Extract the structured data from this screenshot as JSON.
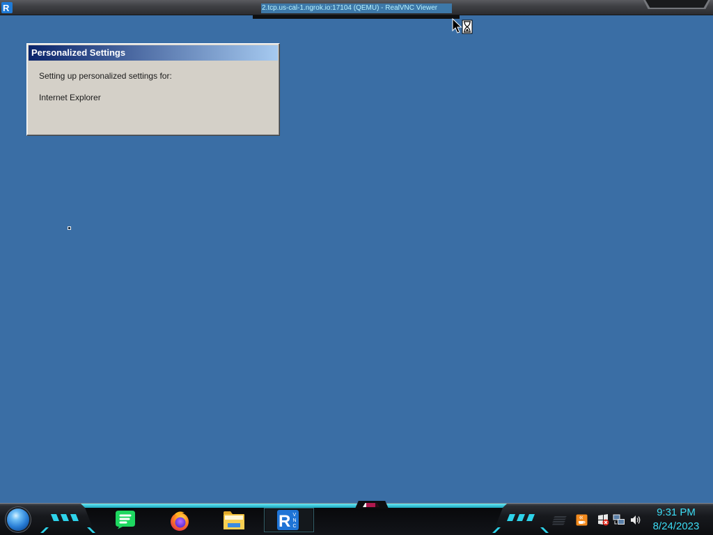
{
  "vnc_viewer": {
    "title": "2.tcp.us-cal-1.ngrok.io:17104 (QEMU) - RealVNC Viewer",
    "icon": "realvnc-icon"
  },
  "realvnc_logo": {
    "mark": "R",
    "letters": [
      "V",
      "N",
      "C"
    ]
  },
  "dialog": {
    "title": "Personalized Settings",
    "message": "Setting up personalized settings for:",
    "item": "Internet Explorer"
  },
  "cursor": {
    "icon": "busy-cursor-icon"
  },
  "taskbar": {
    "start_icon": "start-orb-icon",
    "pinned": [
      {
        "icon": "spotify-icon"
      },
      {
        "icon": "firefox-icon"
      },
      {
        "icon": "file-explorer-icon"
      },
      {
        "icon": "realvnc-icon",
        "active": true
      }
    ],
    "tray": [
      {
        "icon": "tray-overflow-icon"
      },
      {
        "icon": "java-icon"
      },
      {
        "icon": "action-center-icon"
      },
      {
        "icon": "network-icon"
      },
      {
        "icon": "volume-icon"
      }
    ],
    "clock": {
      "time": "9:31 PM",
      "date": "8/24/2023"
    }
  },
  "colors": {
    "desktop": "#3a6ea5",
    "accent_cyan": "#2ed3ea",
    "dialog_face": "#d4d0c8",
    "dialog_title_start": "#0a246a",
    "dialog_title_end": "#a6caf0",
    "clock_text": "#3cdcf4",
    "title_highlight": "#3d78a8"
  }
}
